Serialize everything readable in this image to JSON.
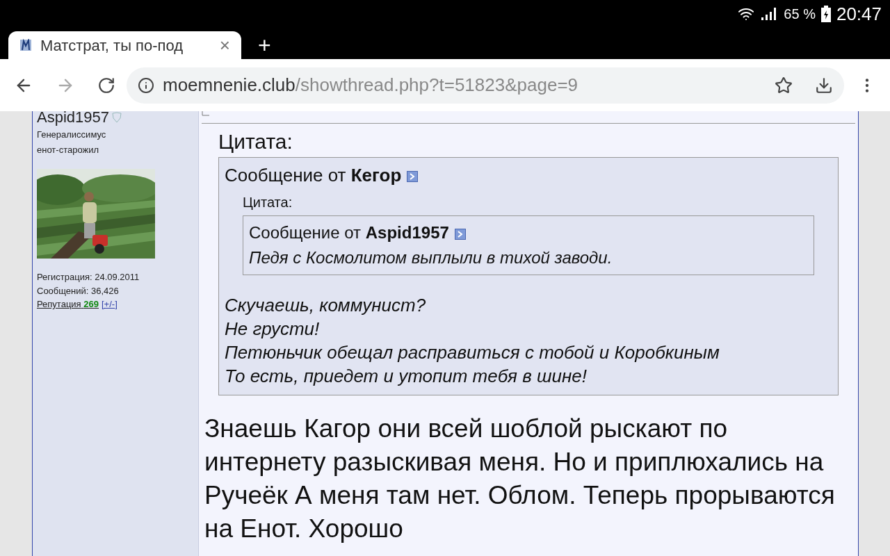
{
  "status_bar": {
    "battery": "65 %",
    "time": "20:47"
  },
  "tab": {
    "title": "Матстрат, ты по-под",
    "close": "×"
  },
  "new_tab": "+",
  "address_bar": {
    "domain": "moemnenie.club",
    "path": "/showthread.php?t=51823&page=9"
  },
  "author": {
    "name": "Aspid1957",
    "rank": "Генералиссимус",
    "title": "енот-старожил",
    "registration": "Регистрация: 24.09.2011",
    "posts": "Сообщений: 36,426",
    "reputation_label": "Репутация",
    "reputation_value": "269",
    "reputation_link": "[+/-]"
  },
  "post": {
    "quote_label": "Цитата:",
    "quote_from": "Сообщение от",
    "quote_author": "Кегор",
    "inner_quote_label": "Цитата:",
    "inner_quote_from": "Сообщение от",
    "inner_quote_author": "Aspid1957",
    "inner_quote_text": "Педя с Космолитом выплыли в тихой заводи.",
    "quote_lines": [
      "Скучаешь, коммунист?",
      "Не грусти!",
      "Петюньчик обещал расправиться с тобой и Коробкиным",
      "То есть, приедет и утопит тебя в шине!"
    ],
    "text": "Знаешь Кагор они всей шоблой рыскают по интернету разыскивая меня. Но и приплюхались на Ручеёк А меня там нет. Облом. Теперь прорываются на Енот. Хорошо"
  }
}
